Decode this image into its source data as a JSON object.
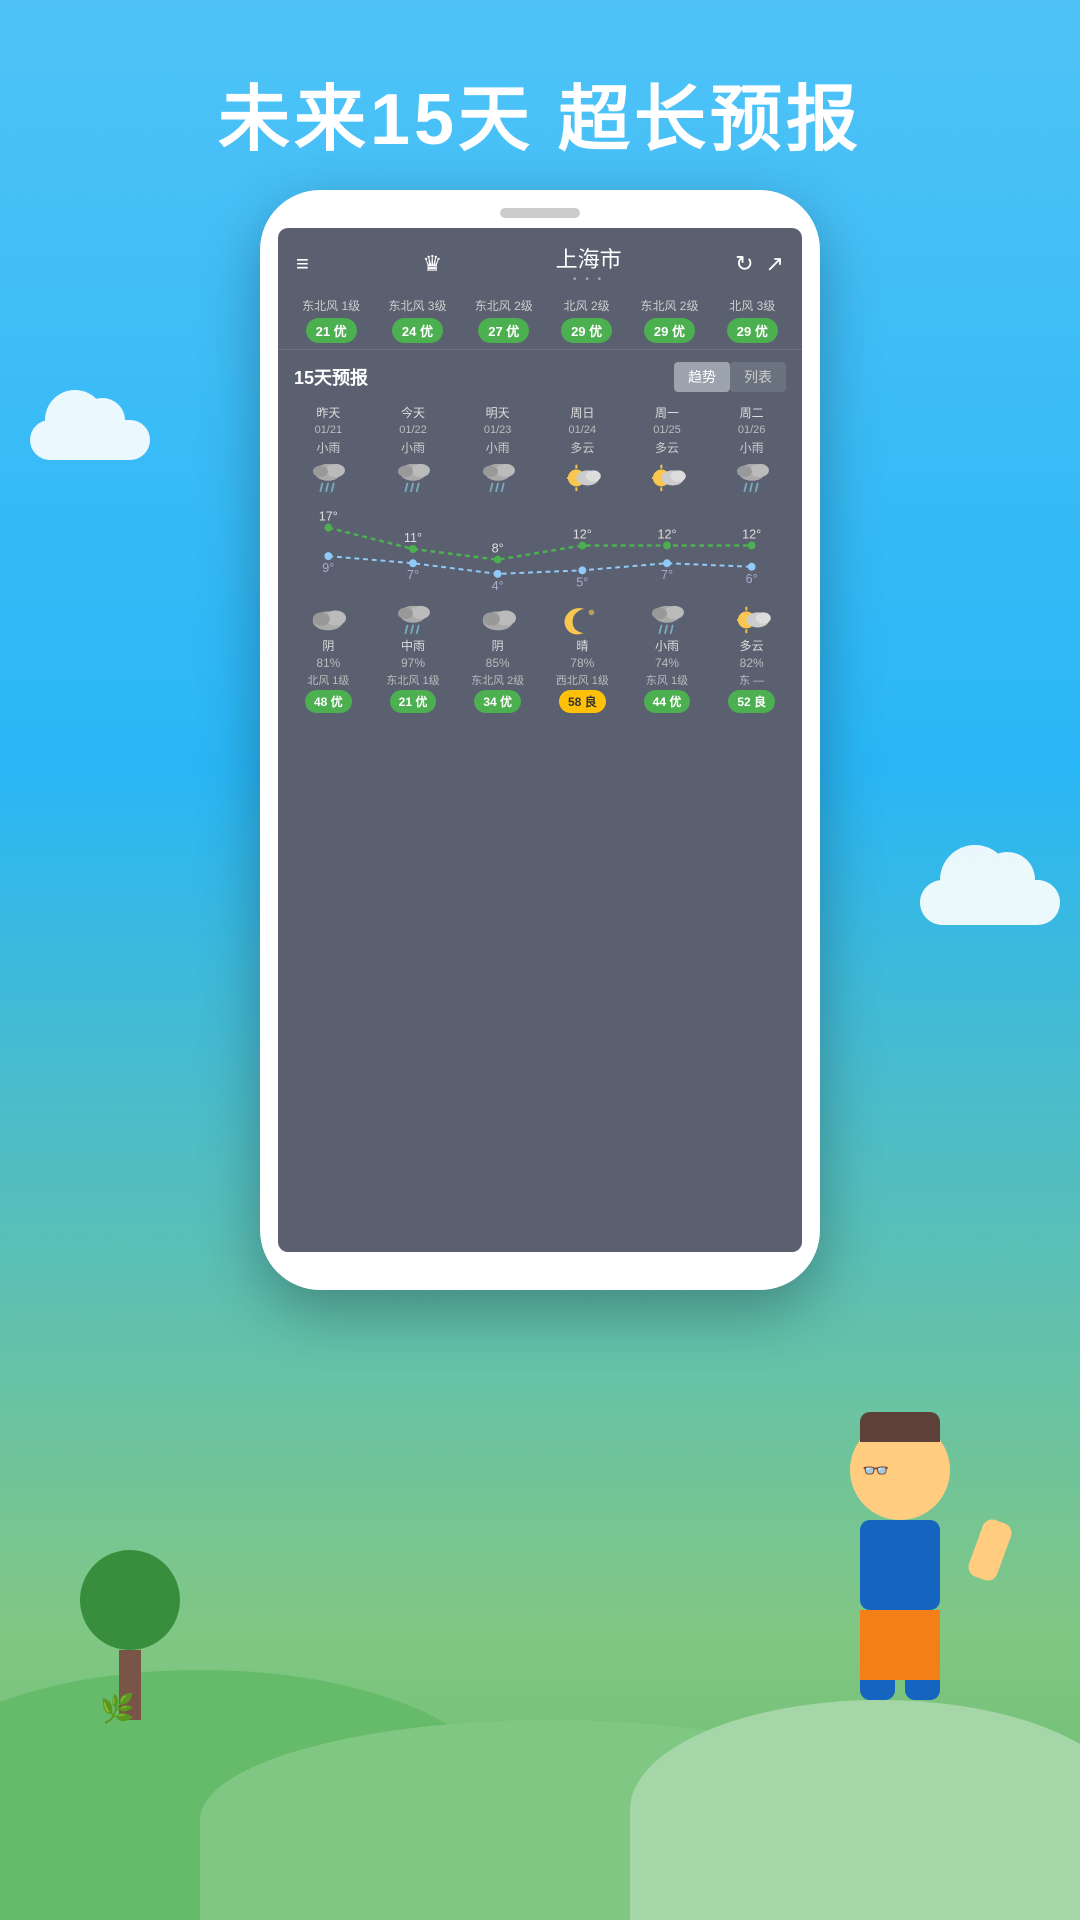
{
  "page": {
    "title": "未来15天  超长预报",
    "background_top": "#29b6f6",
    "background_bottom": "#66bb6a"
  },
  "header": {
    "menu_icon": "≡",
    "crown_icon": "♛",
    "city": "上海市",
    "dots": "• • •",
    "refresh_icon": "↻",
    "share_icon": "↗"
  },
  "aqi_row": [
    {
      "wind": "东北风\n1级",
      "aqi": "21 优",
      "type": "green"
    },
    {
      "wind": "东北风\n3级",
      "aqi": "24 优",
      "type": "green"
    },
    {
      "wind": "东北风\n2级",
      "aqi": "27 优",
      "type": "green"
    },
    {
      "wind": "北风\n2级",
      "aqi": "29 优",
      "type": "green"
    },
    {
      "wind": "东北风\n2级",
      "aqi": "29 优",
      "type": "green"
    },
    {
      "wind": "北风\n3级",
      "aqi": "29 优",
      "type": "green"
    }
  ],
  "forecast_section": {
    "title": "15天预报",
    "btn_trend": "趋势",
    "btn_list": "列表"
  },
  "forecast_days": [
    {
      "day": "昨天",
      "date": "01/21",
      "condition": "小雨",
      "icon": "rain",
      "high": 17,
      "low": 9
    },
    {
      "day": "今天",
      "date": "01/22",
      "condition": "小雨",
      "icon": "rain",
      "high": 11,
      "low": 7
    },
    {
      "day": "明天",
      "date": "01/23",
      "condition": "小雨",
      "icon": "rain",
      "high": 8,
      "low": 4
    },
    {
      "day": "周日",
      "date": "01/24",
      "condition": "多云",
      "icon": "partlycloudy",
      "high": 12,
      "low": 5
    },
    {
      "day": "周一",
      "date": "01/25",
      "condition": "多云",
      "icon": "partlycloudy",
      "high": 12,
      "low": 7
    },
    {
      "day": "周二",
      "date": "01/26",
      "condition": "小雨",
      "icon": "rain",
      "high": 12,
      "low": 6
    }
  ],
  "detail_days": [
    {
      "icon": "cloud",
      "condition": "阴",
      "humidity": "81%",
      "wind": "北风\n1级",
      "aqi": "48 优",
      "aqi_type": "green"
    },
    {
      "icon": "rain",
      "condition": "中雨",
      "humidity": "97%",
      "wind": "东北风\n1级",
      "aqi": "21 优",
      "aqi_type": "green"
    },
    {
      "icon": "cloud",
      "condition": "阴",
      "humidity": "85%",
      "wind": "东北风\n2级",
      "aqi": "34 优",
      "aqi_type": "green"
    },
    {
      "icon": "moon",
      "condition": "晴",
      "humidity": "78%",
      "wind": "西北风\n1级",
      "aqi": "58 良",
      "aqi_type": "yellow"
    },
    {
      "icon": "rain",
      "condition": "小雨",
      "humidity": "74%",
      "wind": "东风\n1级",
      "aqi": "44 优",
      "aqi_type": "green"
    },
    {
      "icon": "partlycloudy",
      "condition": "多云",
      "humidity": "82%",
      "wind": "东\n—",
      "aqi": "52 良",
      "aqi_type": "green"
    }
  ],
  "colors": {
    "green_badge": "#4caf50",
    "yellow_badge": "#ffc107",
    "screen_bg": "#5a6070",
    "high_line": "#4caf50",
    "low_line": "#90caf9"
  }
}
